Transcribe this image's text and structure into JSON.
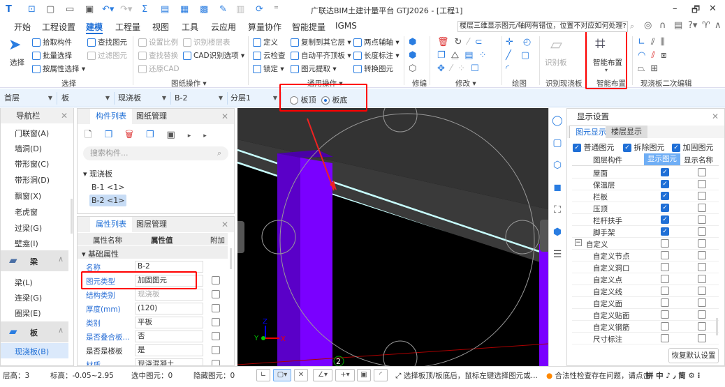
{
  "title": "广联达BIM土建计量平台 GTJ2026 - [工程1]",
  "window_controls": [
    "–",
    "🗗",
    "✕"
  ],
  "menus": [
    "开始",
    "工程设置",
    "建模",
    "工程量",
    "视图",
    "工具",
    "云应用",
    "算量协作",
    "智能提量",
    "IGMS"
  ],
  "active_menu": "建模",
  "search_text": "楼层三维显示图元/轴网有错位，位置不对应如何处理?",
  "ribbon": {
    "select": {
      "label": "选择",
      "big": "选择",
      "items": [
        "拾取构件",
        "批量选择",
        "按属性选择 ▾",
        "查找图元",
        "过滤图元"
      ]
    },
    "drawing": {
      "label": "图纸操作 ▾",
      "items": [
        "设置比例",
        "识别楼层表",
        "查找替换",
        "CAD识别选项 ▾",
        "还原CAD"
      ]
    },
    "common": {
      "label": "通用操作 ▾",
      "items": [
        "定义",
        "云检查",
        "锁定 ▾",
        "复制到其它层 ▾",
        "自动平齐顶板 ▾",
        "图元提取 ▾",
        "两点辅轴 ▾",
        "长度标注 ▾",
        "转换图元"
      ]
    },
    "repair": {
      "label": "修编"
    },
    "modify": {
      "label": "修改 ▾"
    },
    "draw": {
      "label": "绘图"
    },
    "recognize": {
      "label": "识别现浇板",
      "big": "识别板"
    },
    "smart": {
      "label": "智能布置",
      "big": "智能布置"
    },
    "secondary": {
      "label": "现浇板二次编辑"
    }
  },
  "selectors": {
    "floor": "首层",
    "type": "板",
    "subtype": "现浇板",
    "component": "B-2",
    "layer": "分层1"
  },
  "radio": {
    "top": "板顶",
    "bottom": "板底",
    "selected": "板底"
  },
  "nav": {
    "title": "导航栏",
    "items": [
      "门联窗(A)",
      "墙洞(D)",
      "带形窗(C)",
      "带形洞(D)",
      "飘窗(X)",
      "老虎窗",
      "过梁(G)",
      "壁龛(I)"
    ],
    "group_beam": "梁",
    "beam_items": [
      "梁(L)",
      "连梁(G)",
      "圈梁(E)"
    ],
    "group_slab": "板",
    "slab_items": [
      "现浇板(B)"
    ]
  },
  "component_list": {
    "tabs": [
      "构件列表",
      "图纸管理"
    ],
    "search_placeholder": "搜索构件...",
    "group": "现浇板",
    "items": [
      "B-1 <1>",
      "B-2 <1>"
    ],
    "selected": "B-2 <1>"
  },
  "properties": {
    "tabs": [
      "属性列表",
      "图层管理"
    ],
    "headers": [
      "属性名称",
      "属性值",
      "附加"
    ],
    "section": "基础属性",
    "rows": [
      {
        "name": "名称",
        "value": "B-2"
      },
      {
        "name": "图元类型",
        "value": "加固图元"
      },
      {
        "name": "结构类别",
        "value": "现浇板"
      },
      {
        "name": "厚度(mm)",
        "value": "(120)"
      },
      {
        "name": "类别",
        "value": "平板"
      },
      {
        "name": "是否叠合板...",
        "value": "否"
      },
      {
        "name": "是否是楼板",
        "value": "是"
      },
      {
        "name": "材质",
        "value": "现浇混凝土"
      }
    ]
  },
  "viewport": {
    "axis_labels": [
      "Z",
      "Y",
      "X"
    ],
    "grid_marker": "2",
    "colors": {
      "column": "#7a00ff",
      "slab_edge": "#c8ffff"
    }
  },
  "display": {
    "title": "显示设置",
    "tabs": [
      "图元显示",
      "楼层显示"
    ],
    "filters": [
      "普通图元",
      "拆除图元",
      "加固图元"
    ],
    "headers": [
      "图层构件",
      "显示图元",
      "显示名称"
    ],
    "rows": [
      {
        "name": "屋面",
        "show": true
      },
      {
        "name": "保温层",
        "show": true
      },
      {
        "name": "栏板",
        "show": true
      },
      {
        "name": "压顶",
        "show": true
      },
      {
        "name": "栏杆扶手",
        "show": true
      },
      {
        "name": "脚手架",
        "show": true
      },
      {
        "name": "自定义",
        "show": false,
        "group": true
      },
      {
        "name": "自定义节点",
        "show": false
      },
      {
        "name": "自定义洞口",
        "show": false
      },
      {
        "name": "自定义点",
        "show": false
      },
      {
        "name": "自定义线",
        "show": false
      },
      {
        "name": "自定义面",
        "show": false
      },
      {
        "name": "自定义贴面",
        "show": false
      },
      {
        "name": "自定义钢筋",
        "show": false
      },
      {
        "name": "尺寸标注",
        "show": false
      }
    ],
    "reset": "恢复默认设置"
  },
  "status": {
    "floor_height": "层高：3",
    "elevation": "标高：-0.05~2.95",
    "selected": "选中图元：0",
    "hidden": "隐藏图元：0",
    "hint": "选择板顶/板底后，鼠标左键选择图元或...",
    "warning": "合法性检查存在问题，请点击",
    "ime": "拼 中 ♪ ٫ 简 ⚙ ⁝"
  }
}
